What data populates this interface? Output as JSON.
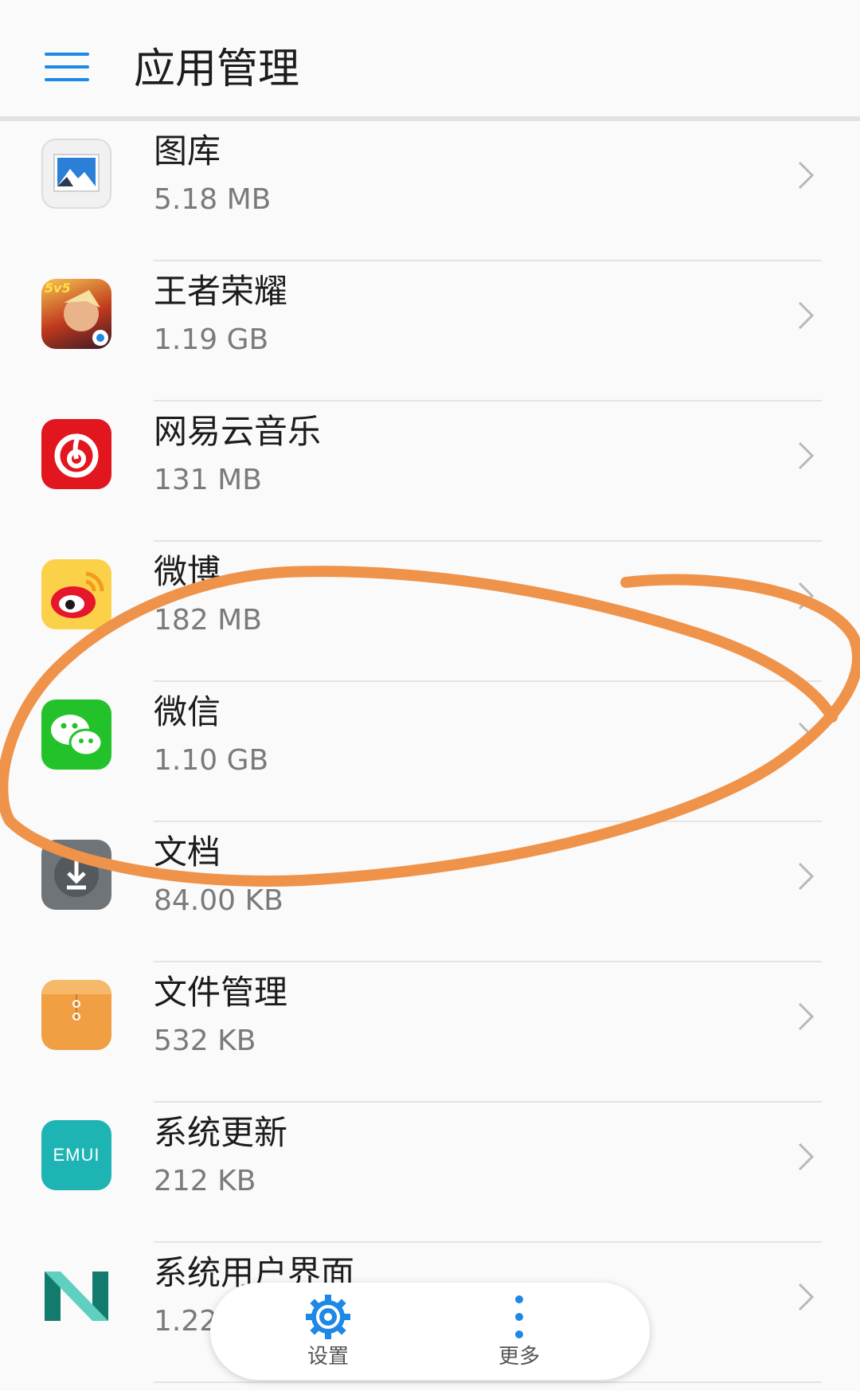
{
  "header": {
    "title": "应用管理"
  },
  "apps": [
    {
      "name": "图库",
      "size": "5.18 MB",
      "icon": "gallery-icon"
    },
    {
      "name": "王者荣耀",
      "size": "1.19 GB",
      "icon": "honor-of-kings-icon",
      "icon_text": "5v5"
    },
    {
      "name": "网易云音乐",
      "size": "131 MB",
      "icon": "netease-music-icon"
    },
    {
      "name": "微博",
      "size": "182 MB",
      "icon": "weibo-icon"
    },
    {
      "name": "微信",
      "size": "1.10 GB",
      "icon": "wechat-icon"
    },
    {
      "name": "文档",
      "size": "84.00 KB",
      "icon": "documents-icon"
    },
    {
      "name": "文件管理",
      "size": "532 KB",
      "icon": "file-manager-icon"
    },
    {
      "name": "系统更新",
      "size": "212 KB",
      "icon": "system-update-icon",
      "icon_text": "EMUI"
    },
    {
      "name": "系统用户界面",
      "size": "1.22 MB",
      "icon": "system-ui-icon"
    }
  ],
  "bottom_bar": {
    "settings_label": "设置",
    "more_label": "更多"
  },
  "colors": {
    "accent": "#1e88e5",
    "annotation": "#f0934a",
    "wechat": "#24c22a",
    "netease": "#e1161f",
    "emui": "#1fb4b4"
  }
}
